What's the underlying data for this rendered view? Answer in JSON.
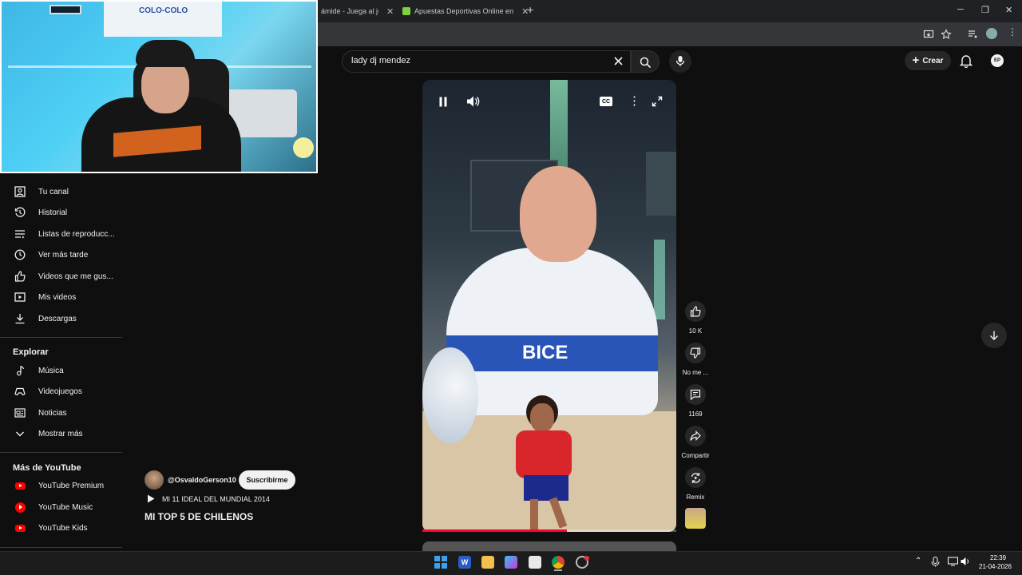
{
  "browser": {
    "tabs": [
      {
        "title": "ámide - Juega al ju",
        "favicon_color": "#e8a33d"
      },
      {
        "title": "Apuestas Deportivas Online en",
        "favicon_color": "#7cd33c"
      }
    ],
    "new_tab": "+",
    "window_controls": {
      "minimize": "─",
      "maximize": "❐",
      "close": "✕"
    }
  },
  "header": {
    "search_query": "lady dj mendez",
    "create_label": "Crear"
  },
  "webcam": {
    "banner_text": "COLO-COLO"
  },
  "sidebar": {
    "you_items": [
      {
        "label": "Tu canal",
        "icon": "user-square-icon"
      },
      {
        "label": "Historial",
        "icon": "history-icon"
      },
      {
        "label": "Listas de reproducc...",
        "icon": "playlist-icon"
      },
      {
        "label": "Ver más tarde",
        "icon": "clock-icon"
      },
      {
        "label": "Videos que me gus...",
        "icon": "thumbs-up-icon"
      },
      {
        "label": "Mis videos",
        "icon": "my-videos-icon"
      },
      {
        "label": "Descargas",
        "icon": "download-icon"
      }
    ],
    "explore_heading": "Explorar",
    "explore_items": [
      {
        "label": "Música",
        "icon": "music-icon"
      },
      {
        "label": "Videojuegos",
        "icon": "gamepad-icon"
      },
      {
        "label": "Noticias",
        "icon": "news-icon"
      },
      {
        "label": "Mostrar más",
        "icon": "chevron-down-icon"
      }
    ],
    "more_heading": "Más de YouTube",
    "more_items": [
      {
        "label": "YouTube Premium",
        "icon": "youtube-premium-icon"
      },
      {
        "label": "YouTube Music",
        "icon": "youtube-music-icon"
      },
      {
        "label": "YouTube Kids",
        "icon": "youtube-kids-icon"
      }
    ]
  },
  "short": {
    "channel_handle": "@OsvaldoGerson10",
    "subscribe_label": "Suscribirme",
    "playlist_label": "MI 11 IDEAL DEL MUNDIAL 2014",
    "title": "MI TOP 5 DE CHILENOS",
    "jersey_text": "BICE",
    "progress": 0.57
  },
  "actions": {
    "likes": "10 K",
    "dislike_label": "No me ...",
    "comments": "1169",
    "share_label": "Compartir",
    "remix_label": "Remix"
  },
  "taskbar": {
    "time": "22:39",
    "date": "21-04-2026"
  }
}
